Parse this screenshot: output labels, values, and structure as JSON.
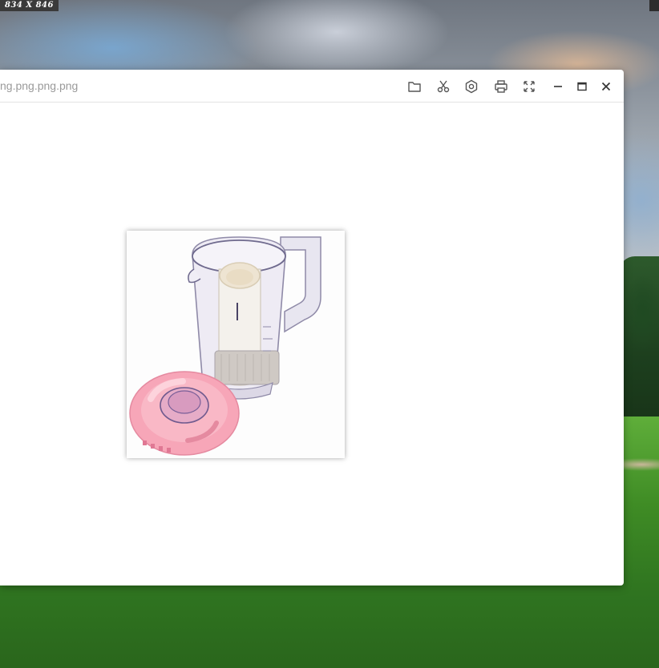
{
  "desktop": {
    "size_badge": "834 X 846"
  },
  "window": {
    "title": "ng.png.png.png",
    "toolbar": {
      "open_icon": "folder-icon",
      "crop_icon": "scissors-icon",
      "settings_icon": "gear-icon",
      "print_icon": "printer-icon",
      "fullscreen_icon": "expand-icon"
    },
    "controls": {
      "minimize_icon": "minimize-icon",
      "maximize_icon": "maximize-icon",
      "close_icon": "close-icon"
    }
  },
  "image": {
    "subject": "blender-jar-icon",
    "colors": {
      "lid": "#f7a6b8",
      "jar": "#c9c4d8"
    }
  }
}
